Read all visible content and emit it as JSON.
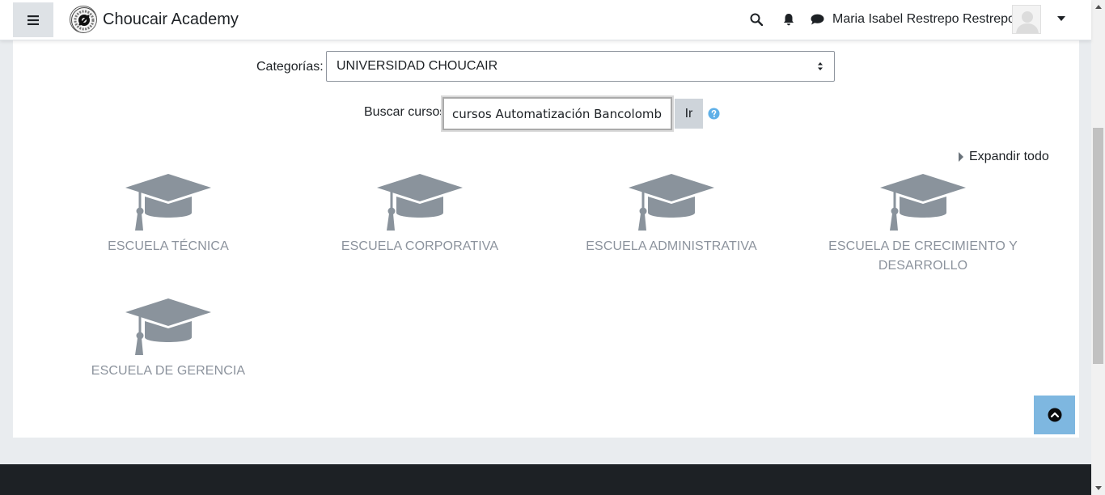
{
  "navbar": {
    "site_name": "Choucair Academy",
    "user_name": "Maria Isabel Restrepo Restrepo",
    "icons": [
      "menu-icon",
      "search-icon",
      "bell-icon",
      "chat-icon",
      "chevron-down-icon"
    ]
  },
  "filters": {
    "category_label": "Categorías:",
    "category_value": "UNIVERSIDAD CHOUCAIR",
    "search_label": "Buscar cursos",
    "search_value": "cursos Automatización Bancolombia",
    "go_label": "Ir"
  },
  "expand_all_label": "Expandir todo",
  "schools": [
    {
      "name": "ESCUELA TÉCNICA"
    },
    {
      "name": "ESCUELA CORPORATIVA"
    },
    {
      "name": "ESCUELA ADMINISTRATIVA"
    },
    {
      "name": "ESCUELA DE CRECIMIENTO Y DESARROLLO"
    },
    {
      "name": "ESCUELA DE GERENCIA"
    }
  ],
  "colors": {
    "accent_back_to_top": "#7eb7e0",
    "school_text": "#8c939d",
    "footer": "#1d2125",
    "help_icon": "#5fb0e8"
  }
}
